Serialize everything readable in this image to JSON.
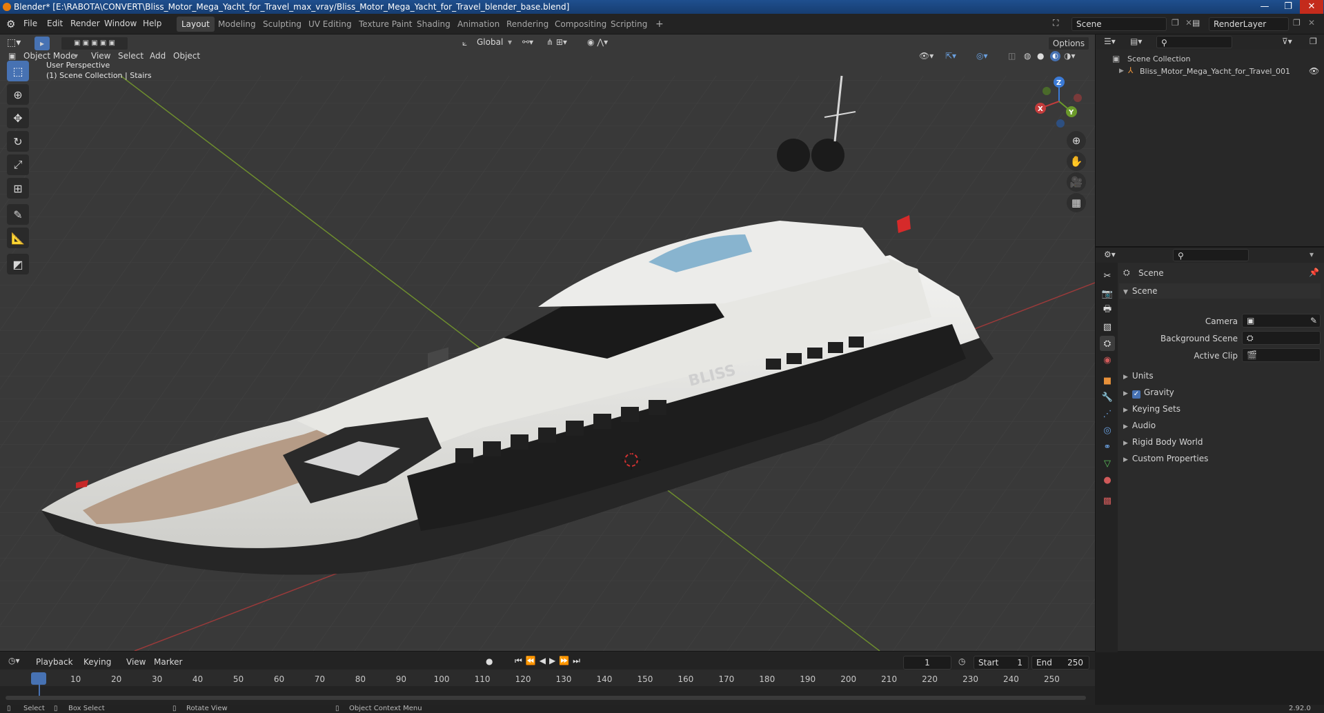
{
  "title_bar": {
    "text": "Blender* [E:\\RABOTA\\CONVERT\\Bliss_Motor_Mega_Yacht_for_Travel_max_vray/Bliss_Motor_Mega_Yacht_for_Travel_blender_base.blend]",
    "minimize": "—",
    "maximize": "❐",
    "close": "✕"
  },
  "menus": [
    "File",
    "Edit",
    "Render",
    "Window",
    "Help"
  ],
  "workspaces": [
    "Layout",
    "Modeling",
    "Sculpting",
    "UV Editing",
    "Texture Paint",
    "Shading",
    "Animation",
    "Rendering",
    "Compositing",
    "Scripting",
    "+"
  ],
  "active_workspace": "Layout",
  "scene_field": "Scene",
  "render_layer_field": "RenderLayer",
  "viewport": {
    "transform_orientation": "Global",
    "options_label": "Options",
    "mode": "Object Mode",
    "header_menus": [
      "View",
      "Select",
      "Add",
      "Object"
    ],
    "overlay_title": "User Perspective",
    "overlay_subtitle": "(1) Scene Collection | Stairs",
    "gizmo_axes": {
      "x": "X",
      "y": "Y",
      "z": "Z"
    },
    "model_logo_text": "BLISS"
  },
  "outliner": {
    "root": "Scene Collection",
    "items": [
      "Bliss_Motor_Mega_Yacht_for_Travel_001"
    ]
  },
  "properties": {
    "context_title": "Scene",
    "panel_title": "Scene",
    "fields": [
      {
        "label": "Camera",
        "value": ""
      },
      {
        "label": "Background Scene",
        "value": ""
      },
      {
        "label": "Active Clip",
        "value": ""
      }
    ],
    "subpanels": [
      "Units",
      "Gravity",
      "Keying Sets",
      "Audio",
      "Rigid Body World",
      "Custom Properties"
    ],
    "gravity_checked": true
  },
  "timeline": {
    "menus": [
      "Playback",
      "Keying",
      "View",
      "Marker"
    ],
    "current_frame": "1",
    "start_label": "Start",
    "start": "1",
    "end_label": "End",
    "end": "250",
    "ticks": [
      "1",
      "10",
      "20",
      "30",
      "40",
      "50",
      "60",
      "70",
      "80",
      "90",
      "100",
      "110",
      "120",
      "130",
      "140",
      "150",
      "160",
      "170",
      "180",
      "190",
      "200",
      "210",
      "220",
      "230",
      "240",
      "250"
    ]
  },
  "status_bar": {
    "select": "Select",
    "box_select": "Box Select",
    "rotate_view": "Rotate View",
    "context_menu": "Object Context Menu",
    "version": "2.92.0"
  },
  "colors": {
    "accent": "#4772b3",
    "titlebar": "#1f4f8e",
    "viewport_bg": "#3a3a3a",
    "x_axis": "#c43c3c",
    "y_axis": "#6b9a2a",
    "z_axis": "#3b7ad6"
  }
}
